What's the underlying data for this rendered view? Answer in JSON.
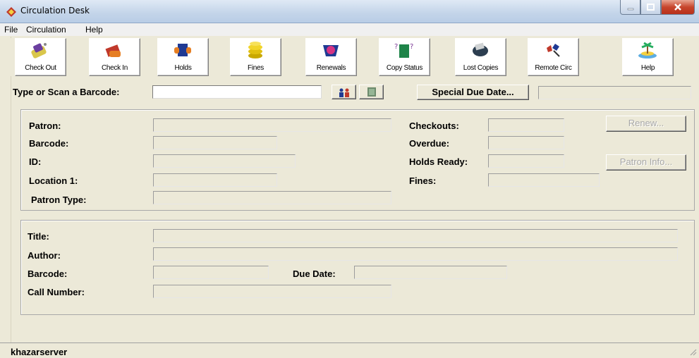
{
  "window": {
    "title": "Circulation Desk"
  },
  "menu": [
    "File",
    "Circulation",
    "Help"
  ],
  "toolbar": [
    {
      "label": "Check Out",
      "icon": "check-out-icon"
    },
    {
      "label": "Check In",
      "icon": "check-in-icon"
    },
    {
      "label": "Holds",
      "icon": "holds-icon"
    },
    {
      "label": "Fines",
      "icon": "fines-icon"
    },
    {
      "label": "Renewals",
      "icon": "renewals-icon"
    },
    {
      "label": "Copy Status",
      "icon": "copy-status-icon"
    },
    {
      "label": "Lost Copies",
      "icon": "lost-copies-icon"
    },
    {
      "label": "Remote Circ",
      "icon": "remote-circ-icon"
    },
    {
      "label": "Help",
      "icon": "help-icon"
    }
  ],
  "scan": {
    "label": "Type or Scan a Barcode:",
    "value": "",
    "special_due_date_label": "Special Due Date...",
    "special_due_date_value": ""
  },
  "patron": {
    "patron_label": "Patron:",
    "barcode_label": "Barcode:",
    "id_label": "ID:",
    "location_label": "Location 1:",
    "patron_type_label": "Patron Type:",
    "checkouts_label": "Checkouts:",
    "overdue_label": "Overdue:",
    "holds_ready_label": "Holds Ready:",
    "fines_label": "Fines:",
    "renew_button": "Renew...",
    "patron_info_button": "Patron Info..."
  },
  "item": {
    "title_label": "Title:",
    "author_label": "Author:",
    "barcode_label": "Barcode:",
    "due_date_label": "Due Date:",
    "call_number_label": "Call Number:"
  },
  "status": {
    "server": "khazarserver"
  },
  "colors": {
    "background": "#ece9d8",
    "field_bg": "#ece9d8",
    "input_bg": "#ffffff"
  }
}
